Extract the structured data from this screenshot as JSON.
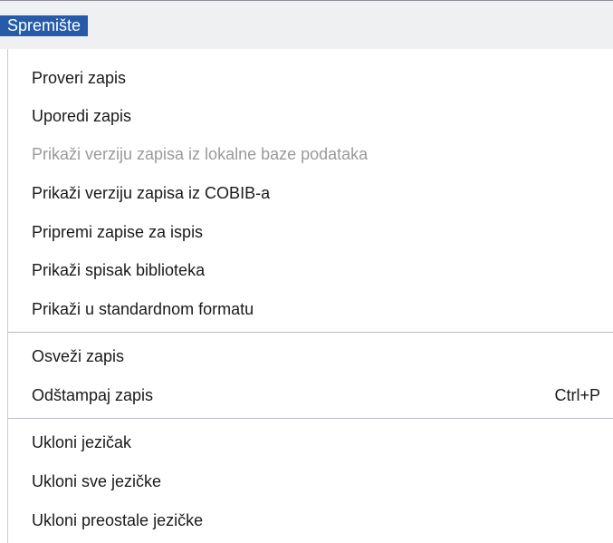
{
  "menubar": {
    "active_menu": "Spremište"
  },
  "menu": {
    "group1": [
      {
        "label": "Proveri zapis",
        "enabled": true
      },
      {
        "label": "Uporedi zapis",
        "enabled": true
      },
      {
        "label": "Prikaži verziju zapisa iz lokalne baze podataka",
        "enabled": false
      },
      {
        "label": "Prikaži verziju zapisa iz COBIB-a",
        "enabled": true
      },
      {
        "label": "Pripremi zapise za ispis",
        "enabled": true
      },
      {
        "label": "Prikaži spisak biblioteka",
        "enabled": true
      },
      {
        "label": "Prikaži u standardnom formatu",
        "enabled": true
      }
    ],
    "group2": [
      {
        "label": "Osveži zapis",
        "enabled": true
      },
      {
        "label": "Odštampaj zapis",
        "shortcut": "Ctrl+P",
        "enabled": true
      }
    ],
    "group3": [
      {
        "label": "Ukloni jezičak",
        "enabled": true
      },
      {
        "label": "Ukloni sve jezičke",
        "enabled": true
      },
      {
        "label": "Ukloni preostale jezičke",
        "enabled": true
      }
    ]
  },
  "colors": {
    "menubar_active_bg": "#255ba8",
    "disabled_text": "#9a9a9a"
  }
}
